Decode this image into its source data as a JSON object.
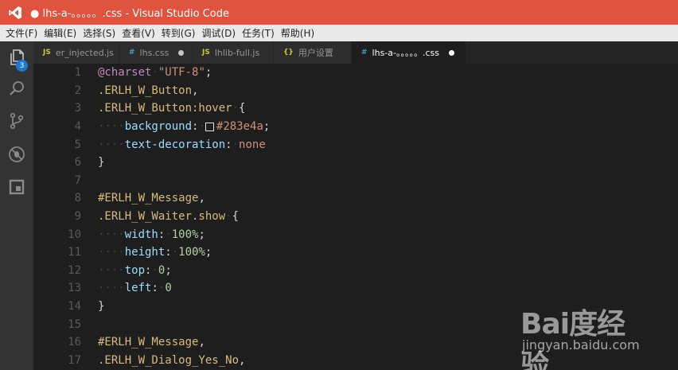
{
  "window": {
    "title": "● lhs-a-。。。。。.css - Visual Studio Code"
  },
  "menu": [
    "文件(F)",
    "编辑(E)",
    "选择(S)",
    "查看(V)",
    "转到(G)",
    "调试(D)",
    "任务(T)",
    "帮助(H)"
  ],
  "activity": {
    "explorer_badge": "3",
    "icons": [
      "files-icon",
      "search-icon",
      "source-control-icon",
      "debug-icon",
      "extensions-icon"
    ]
  },
  "tabs": [
    {
      "type": "JS",
      "label": "er_injected.js",
      "dirty": false
    },
    {
      "type": "#",
      "label": "lhs.css",
      "dirty": true
    },
    {
      "type": "JS",
      "label": "lhlib-full.js",
      "dirty": true
    },
    {
      "type": "{}",
      "label": "用户设置",
      "dirty": false
    },
    {
      "type": "#",
      "label": "lhs-a-。。。。。.css",
      "dirty": true,
      "active": true
    }
  ],
  "editor": {
    "line_numbers": [
      "1",
      "2",
      "3",
      "4",
      "5",
      "6",
      "7",
      "8",
      "9",
      "10",
      "11",
      "12",
      "13",
      "14",
      "15",
      "16",
      "17"
    ],
    "lines": [
      [
        {
          "c": "t-at",
          "t": "@charset"
        },
        {
          "c": "ws",
          "t": "·"
        },
        {
          "c": "t-str",
          "t": "\"UTF-8\""
        },
        {
          "c": "t-punc",
          "t": ";"
        }
      ],
      [
        {
          "c": "t-sel",
          "t": ".ERLH_W_Button"
        },
        {
          "c": "t-punc",
          "t": ","
        }
      ],
      [
        {
          "c": "t-sel",
          "t": ".ERLH_W_Button:hover"
        },
        {
          "c": "ws",
          "t": "·"
        },
        {
          "c": "t-punc",
          "t": "{"
        }
      ],
      [
        {
          "c": "ws",
          "t": "····"
        },
        {
          "c": "t-prop",
          "t": "background"
        },
        {
          "c": "t-punc",
          "t": ":"
        },
        {
          "c": "ws",
          "t": "·"
        },
        {
          "c": "swatch",
          "t": ""
        },
        {
          "c": "t-val",
          "t": "#283e4a"
        },
        {
          "c": "t-punc",
          "t": ";"
        }
      ],
      [
        {
          "c": "ws",
          "t": "····"
        },
        {
          "c": "t-prop",
          "t": "text-decoration"
        },
        {
          "c": "t-punc",
          "t": ":"
        },
        {
          "c": "ws",
          "t": "·"
        },
        {
          "c": "t-val",
          "t": "none"
        }
      ],
      [
        {
          "c": "t-punc",
          "t": "}"
        }
      ],
      [],
      [
        {
          "c": "t-sel",
          "t": "#ERLH_W_Message"
        },
        {
          "c": "t-punc",
          "t": ","
        }
      ],
      [
        {
          "c": "t-sel",
          "t": ".ERLH_W_Waiter.show"
        },
        {
          "c": "ws",
          "t": "·"
        },
        {
          "c": "t-punc",
          "t": "{"
        }
      ],
      [
        {
          "c": "ws",
          "t": "····"
        },
        {
          "c": "t-prop",
          "t": "width"
        },
        {
          "c": "t-punc",
          "t": ":"
        },
        {
          "c": "ws",
          "t": "·"
        },
        {
          "c": "t-num",
          "t": "100%"
        },
        {
          "c": "t-punc",
          "t": ";"
        }
      ],
      [
        {
          "c": "ws",
          "t": "····"
        },
        {
          "c": "t-prop",
          "t": "height"
        },
        {
          "c": "t-punc",
          "t": ":"
        },
        {
          "c": "ws",
          "t": "·"
        },
        {
          "c": "t-num",
          "t": "100%"
        },
        {
          "c": "t-punc",
          "t": ";"
        }
      ],
      [
        {
          "c": "ws",
          "t": "····"
        },
        {
          "c": "t-prop",
          "t": "top"
        },
        {
          "c": "t-punc",
          "t": ":"
        },
        {
          "c": "ws",
          "t": "·"
        },
        {
          "c": "t-num",
          "t": "0"
        },
        {
          "c": "t-punc",
          "t": ";"
        }
      ],
      [
        {
          "c": "ws",
          "t": "····"
        },
        {
          "c": "t-prop",
          "t": "left"
        },
        {
          "c": "t-punc",
          "t": ":"
        },
        {
          "c": "ws",
          "t": "·"
        },
        {
          "c": "t-num",
          "t": "0"
        }
      ],
      [
        {
          "c": "t-punc",
          "t": "}"
        }
      ],
      [],
      [
        {
          "c": "t-sel",
          "t": "#ERLH_W_Message"
        },
        {
          "c": "t-punc",
          "t": ","
        }
      ],
      [
        {
          "c": "t-sel",
          "t": ".ERLH_W_Dialog_Yes_No"
        },
        {
          "c": "t-punc",
          "t": ","
        }
      ]
    ]
  },
  "watermark": {
    "brand": "Bai度经验",
    "url": "jingyan.baidu.com"
  },
  "colors": {
    "titlebar": "#e0533f",
    "activitybar": "#333333",
    "editor_bg": "#1e1e1e",
    "badge": "#1d7ad0"
  }
}
